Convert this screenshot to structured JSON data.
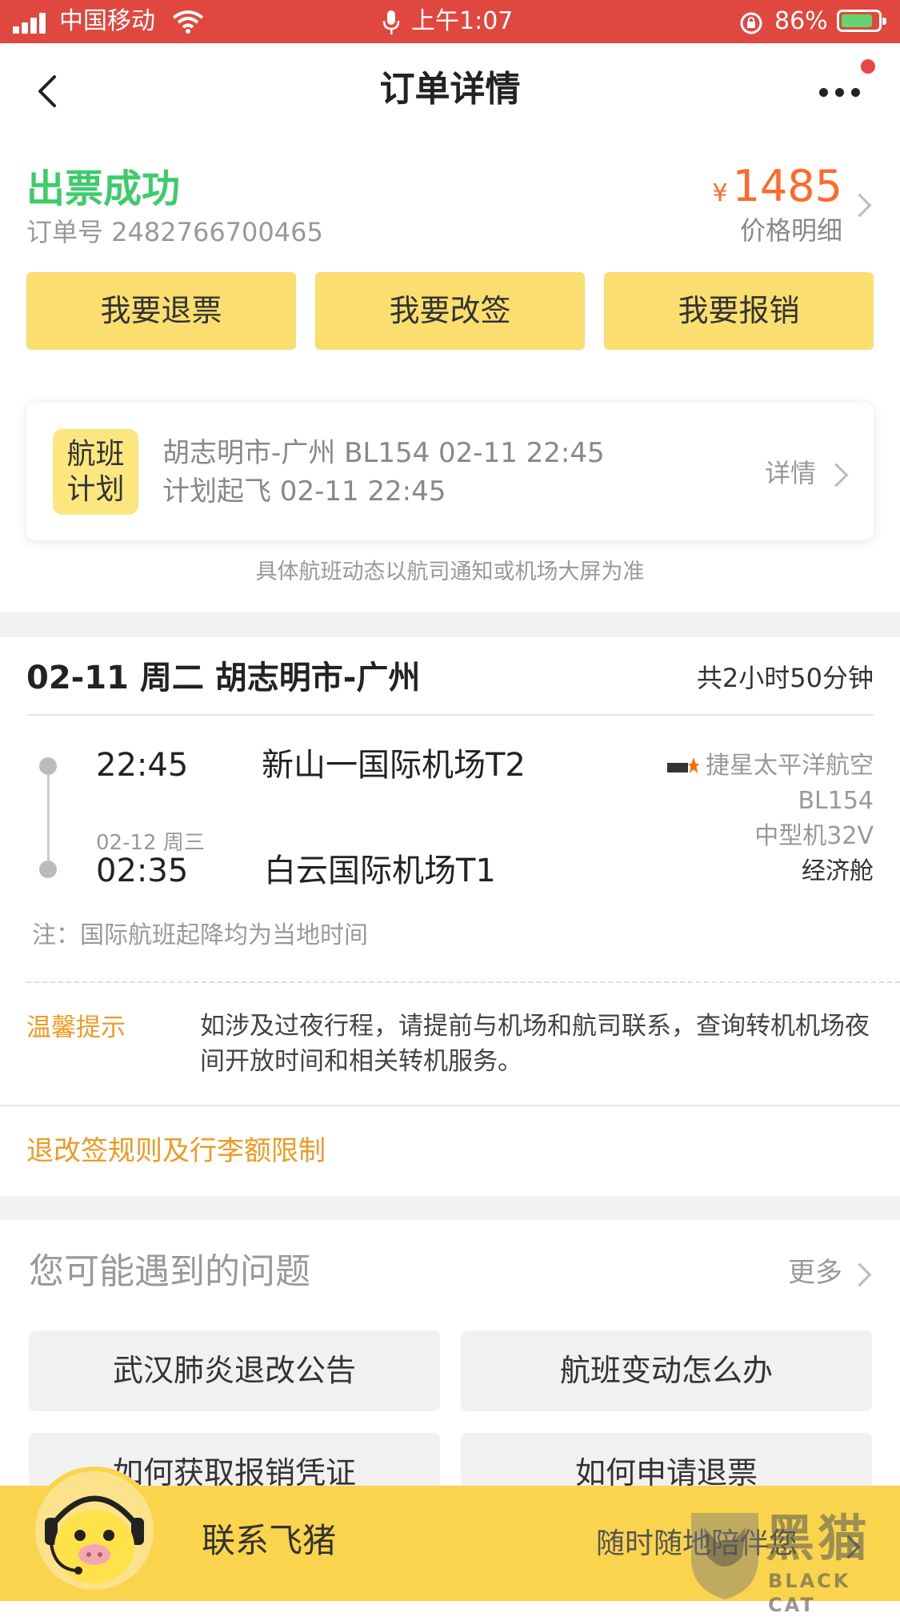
{
  "status_bar": {
    "carrier": "中国移动",
    "time": "上午1:07",
    "battery": "86%",
    "battery_level": 0.86
  },
  "nav": {
    "title": "订单详情"
  },
  "order": {
    "status": "出票成功",
    "order_no": "订单号 2482766700465",
    "currency": "¥",
    "price": "1485",
    "price_detail": "价格明细",
    "actions": [
      "我要退票",
      "我要改签",
      "我要报销"
    ]
  },
  "flight_plan": {
    "badge_line1": "航班",
    "badge_line2": "计划",
    "line1": "胡志明市-广州 BL154 02-11 22:45",
    "line2": "计划起飞 02-11 22:45",
    "detail": "详情",
    "note": "具体航班动态以航司通知或机场大屏为准"
  },
  "itinerary": {
    "route_title": "02-11 周二 胡志明市-广州",
    "duration": "共2小时50分钟",
    "depart_time": "22:45",
    "depart_airport": "新山一国际机场T2",
    "arrive_date": "02-12 周三",
    "arrive_time": "02:35",
    "arrive_airport": "白云国际机场T1",
    "airline": "捷星太平洋航空",
    "flight_no": "BL154",
    "aircraft": "中型机32V",
    "cabin": "经济舱",
    "local_note": "注：国际航班起降均为当地时间",
    "tip_label": "温馨提示",
    "tip_text": "如涉及过夜行程，请提前与机场和航司联系，查询转机机场夜间开放时间和相关转机服务。",
    "rules_link": "退改签规则及行李额限制"
  },
  "questions": {
    "title": "您可能遇到的问题",
    "more": "更多",
    "items": [
      "武汉肺炎退改公告",
      "航班变动怎么办",
      "如何获取报销凭证",
      "如何申请退票"
    ]
  },
  "bottom_bar": {
    "contact": "联系飞猪",
    "subtitle": "随时随地陪伴您",
    "watermark": "黑猫",
    "watermark_en": "BLACK CAT"
  },
  "colors": {
    "status_bar": "#e0483f",
    "success_green": "#3dcc6a",
    "price_orange": "#ff6a2b",
    "button_yellow": "#fade6f",
    "tip_orange": "#f09a22",
    "bottom_yellow": "#fbd44e"
  }
}
